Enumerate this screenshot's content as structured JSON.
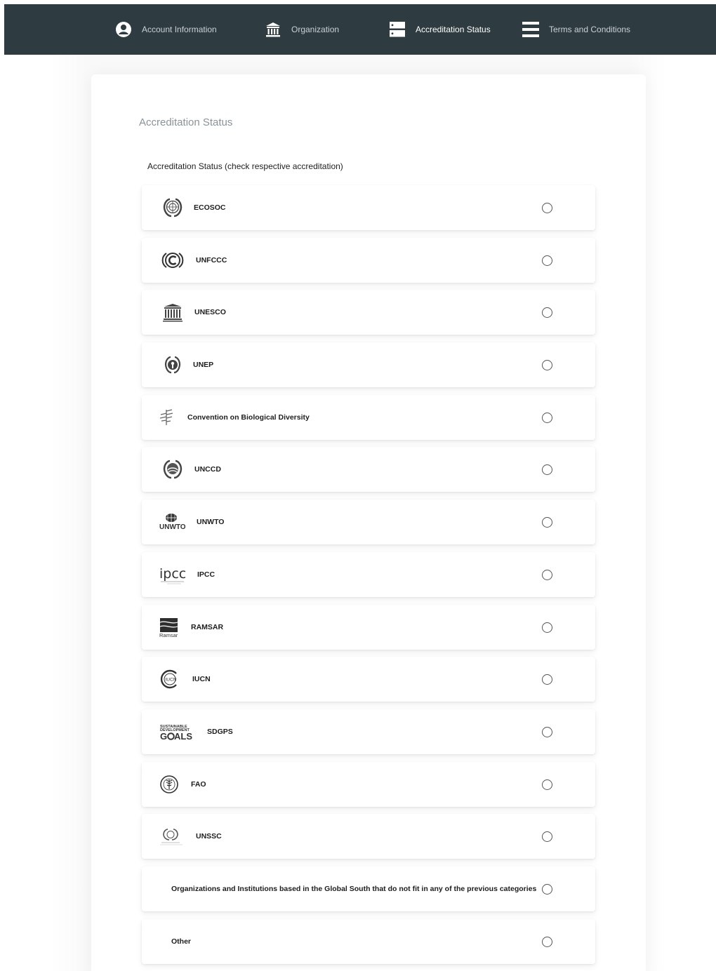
{
  "nav": {
    "items": [
      {
        "label": "Account Information",
        "icon": "user-circle-icon",
        "active": false
      },
      {
        "label": "Organization",
        "icon": "institution-icon",
        "active": false
      },
      {
        "label": "Accreditation Status",
        "icon": "server-icon",
        "active": true
      },
      {
        "label": "Terms and Conditions",
        "icon": "menu-lines-icon",
        "active": false
      }
    ]
  },
  "form": {
    "section_title": "Accreditation Status",
    "field_label": "Accreditation Status (check respective accreditation)",
    "options": [
      {
        "label": "ECOSOC",
        "logo": "un-emblem-logo"
      },
      {
        "label": "UNFCCC",
        "logo": "unfccc-logo"
      },
      {
        "label": "UNESCO",
        "logo": "unesco-temple-logo"
      },
      {
        "label": "UNEP",
        "logo": "unep-logo"
      },
      {
        "label": "Convention on Biological Diversity",
        "logo": "cbd-leaf-logo"
      },
      {
        "label": "UNCCD",
        "logo": "unccd-logo"
      },
      {
        "label": "UNWTO",
        "logo": "unwto-logo",
        "logo_text": "UNWTO"
      },
      {
        "label": "IPCC",
        "logo": "ipcc-logo",
        "logo_text": "ipcc"
      },
      {
        "label": "RAMSAR",
        "logo": "ramsar-logo",
        "logo_text": "Ramsar"
      },
      {
        "label": "IUCN",
        "logo": "iucn-logo",
        "logo_text": "IUCN"
      },
      {
        "label": "SDGPS",
        "logo": "sdg-goals-logo",
        "logo_text": "SUSTAINABLE DEVELOPMENT GOALS"
      },
      {
        "label": "FAO",
        "logo": "fao-logo"
      },
      {
        "label": "UNSSC",
        "logo": "unssc-logo"
      },
      {
        "label": "Organizations and Institutions based in the Global South that do not fit in any of the previous categories",
        "logo": ""
      },
      {
        "label": "Other",
        "logo": ""
      }
    ]
  },
  "colors": {
    "nav_background": "#2e3b41",
    "nav_text": "#c9d0d3",
    "nav_active_text": "#ffffff",
    "section_title": "#8a9399"
  }
}
